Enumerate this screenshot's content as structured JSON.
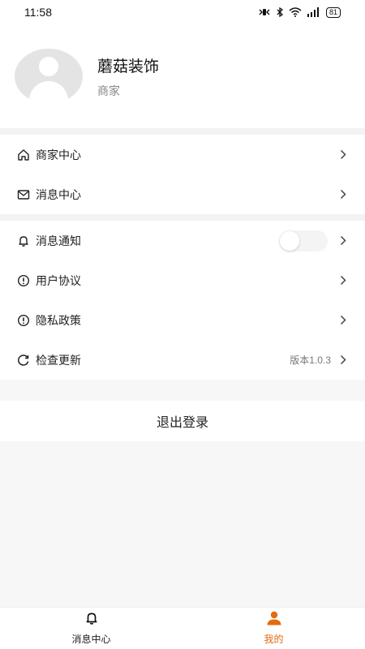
{
  "status_bar": {
    "time": "11:58",
    "battery": "81"
  },
  "profile": {
    "name": "蘑菇装饰",
    "role": "商家"
  },
  "menu_group_1": [
    {
      "label": "商家中心",
      "icon": "home-icon"
    },
    {
      "label": "消息中心",
      "icon": "mail-icon"
    }
  ],
  "menu_group_2": [
    {
      "label": "消息通知",
      "icon": "bell-icon",
      "toggle": false
    },
    {
      "label": "用户协议",
      "icon": "info-icon"
    },
    {
      "label": "隐私政策",
      "icon": "info-icon"
    },
    {
      "label": "检查更新",
      "icon": "refresh-icon",
      "value": "版本1.0.3"
    }
  ],
  "logout_label": "退出登录",
  "tabbar": [
    {
      "label": "消息中心",
      "icon": "bell-icon",
      "active": false
    },
    {
      "label": "我的",
      "icon": "user-icon",
      "active": true
    }
  ],
  "colors": {
    "accent": "#e36b10",
    "background": "#f7f7f7",
    "avatar_bg": "#e4e4e4"
  }
}
